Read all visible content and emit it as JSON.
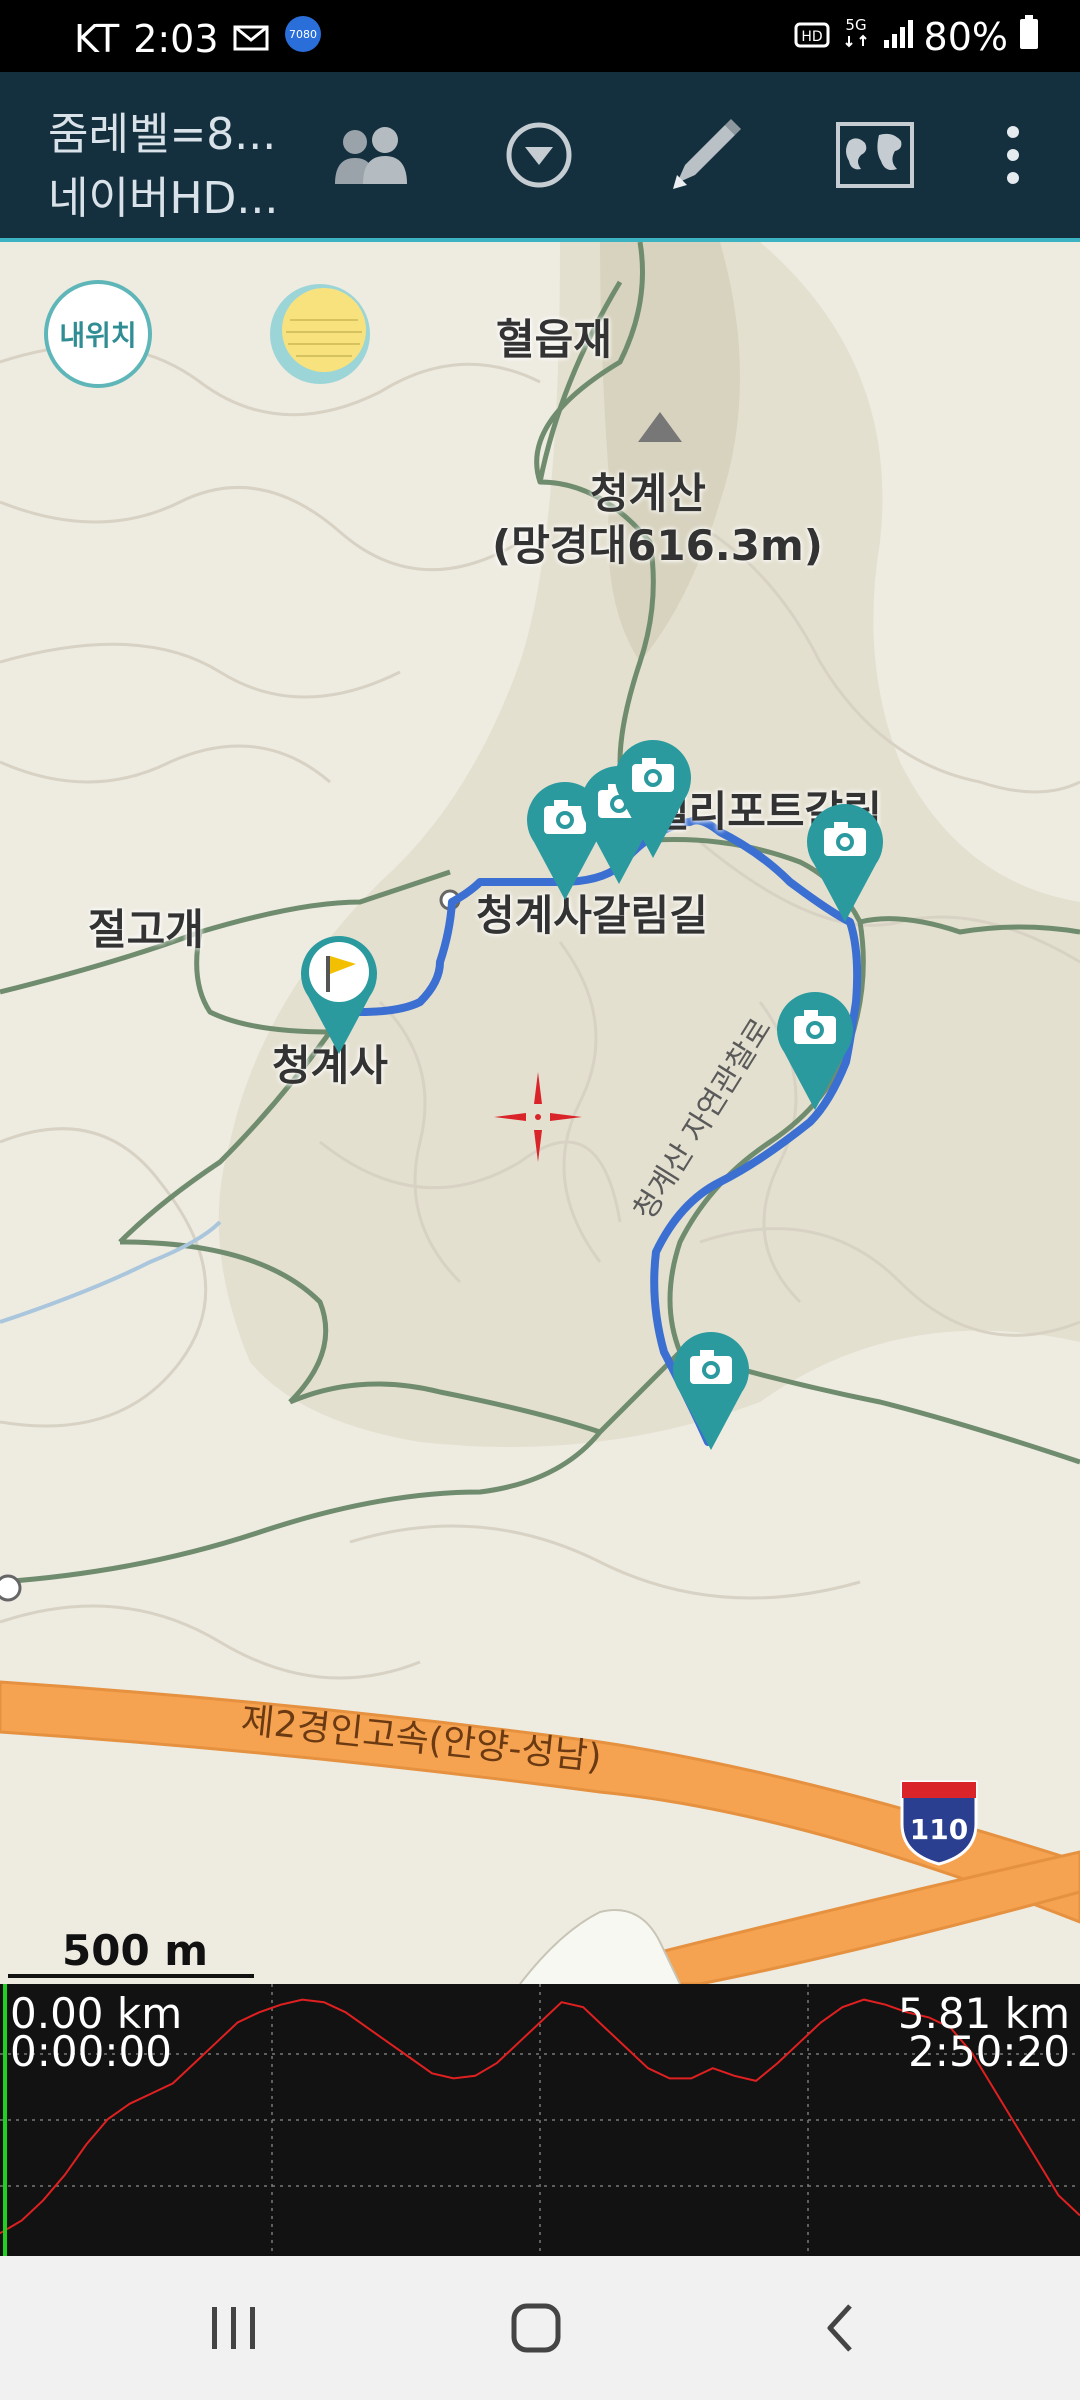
{
  "status_bar": {
    "carrier": "KT",
    "time": "2:03",
    "battery": "80%",
    "icons": [
      "mail-icon",
      "app-notification-icon",
      "hd-voice-icon",
      "5g-icon",
      "signal-icon",
      "battery-icon"
    ],
    "notification_badge_text": "7080"
  },
  "app_bar": {
    "title_line1": "줌레벨=8...",
    "title_line2": "네이버HD...",
    "actions": [
      "group-icon",
      "dropdown-circle-icon",
      "pencil-icon",
      "world-map-icon",
      "more-vert-icon"
    ]
  },
  "map": {
    "my_location_label": "내위치",
    "labels": {
      "hyeopeupjae": "혈읍재",
      "cheonggyesan": "청계산",
      "summit": "(망경대616.3m)",
      "heliport": "헬리포트갈림",
      "galrimgil": "청계사갈림길",
      "jeolgogae": "절고개",
      "cheonggyesa": "청계사",
      "trail_vertical": "청계산 자연관찰로",
      "highway": "제2경인고속(안양-성남)",
      "route_shield": "110"
    },
    "scale_label": "500 m",
    "colors": {
      "track": "#3b6fd1",
      "marker": "#2b9a9f",
      "highway": "#f5a351",
      "trail_border": "#6a8a6a",
      "crosshair": "#d9252a"
    }
  },
  "elevation_profile": {
    "start_distance": "0.00 km",
    "start_time": "0:00:00",
    "end_distance": "5.81 km",
    "end_time": "2:50:20",
    "colors": {
      "line": "#e02020",
      "grid": "#808080",
      "cursor": "#21d121",
      "background": "#121212"
    },
    "profile": [
      0.05,
      0.1,
      0.18,
      0.28,
      0.4,
      0.5,
      0.56,
      0.6,
      0.64,
      0.72,
      0.8,
      0.88,
      0.92,
      0.95,
      0.97,
      0.96,
      0.92,
      0.86,
      0.8,
      0.74,
      0.68,
      0.66,
      0.67,
      0.72,
      0.8,
      0.88,
      0.96,
      0.94,
      0.86,
      0.78,
      0.7,
      0.66,
      0.66,
      0.7,
      0.67,
      0.65,
      0.72,
      0.8,
      0.88,
      0.94,
      0.97,
      0.95,
      0.92,
      0.9,
      0.86,
      0.76,
      0.62,
      0.48,
      0.34,
      0.2,
      0.12
    ]
  },
  "nav_bar": {
    "buttons": [
      "recent-apps-icon",
      "home-icon",
      "back-icon"
    ]
  }
}
